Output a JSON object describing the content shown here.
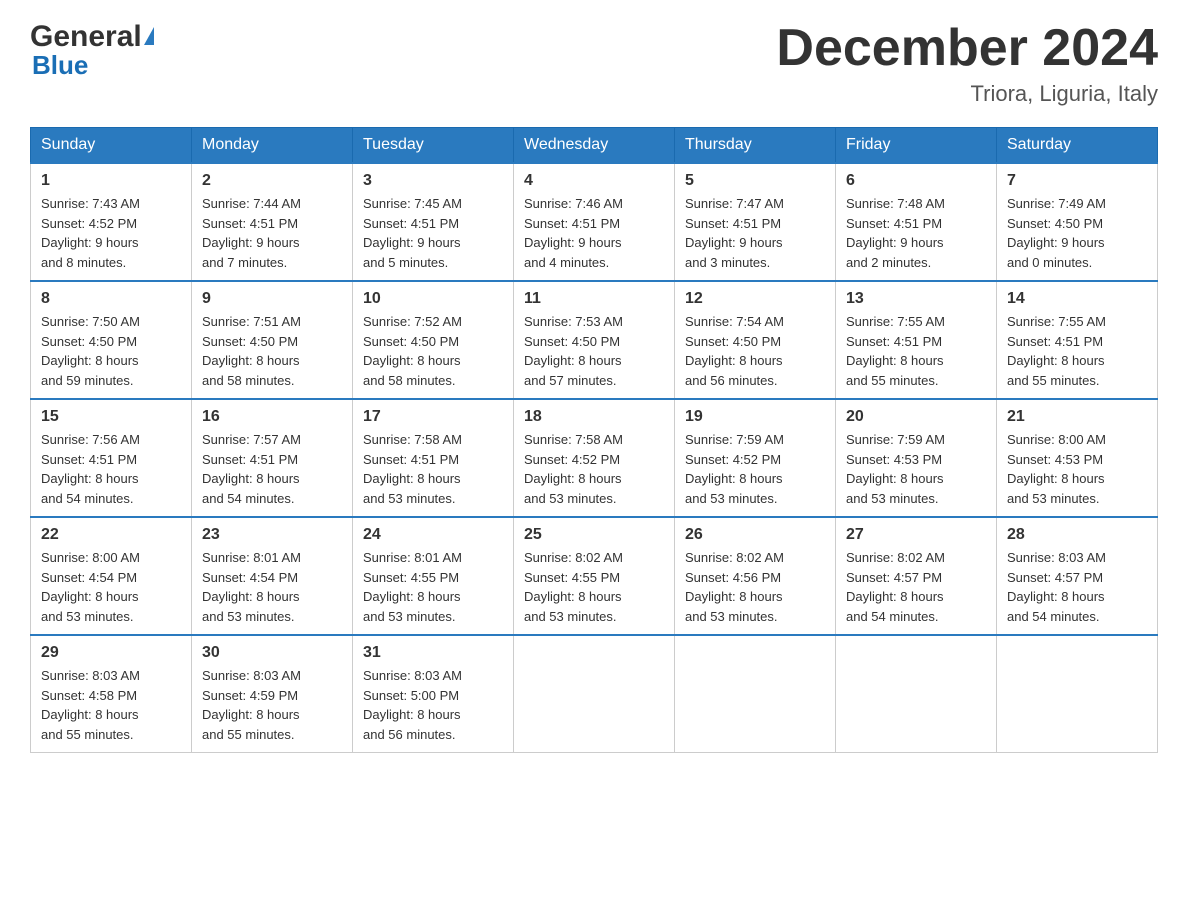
{
  "header": {
    "logo_general": "General",
    "logo_blue": "Blue",
    "month_title": "December 2024",
    "location": "Triora, Liguria, Italy"
  },
  "days_of_week": [
    "Sunday",
    "Monday",
    "Tuesday",
    "Wednesday",
    "Thursday",
    "Friday",
    "Saturday"
  ],
  "weeks": [
    [
      {
        "day": "1",
        "sunrise": "7:43 AM",
        "sunset": "4:52 PM",
        "daylight": "9 hours and 8 minutes."
      },
      {
        "day": "2",
        "sunrise": "7:44 AM",
        "sunset": "4:51 PM",
        "daylight": "9 hours and 7 minutes."
      },
      {
        "day": "3",
        "sunrise": "7:45 AM",
        "sunset": "4:51 PM",
        "daylight": "9 hours and 5 minutes."
      },
      {
        "day": "4",
        "sunrise": "7:46 AM",
        "sunset": "4:51 PM",
        "daylight": "9 hours and 4 minutes."
      },
      {
        "day": "5",
        "sunrise": "7:47 AM",
        "sunset": "4:51 PM",
        "daylight": "9 hours and 3 minutes."
      },
      {
        "day": "6",
        "sunrise": "7:48 AM",
        "sunset": "4:51 PM",
        "daylight": "9 hours and 2 minutes."
      },
      {
        "day": "7",
        "sunrise": "7:49 AM",
        "sunset": "4:50 PM",
        "daylight": "9 hours and 0 minutes."
      }
    ],
    [
      {
        "day": "8",
        "sunrise": "7:50 AM",
        "sunset": "4:50 PM",
        "daylight": "8 hours and 59 minutes."
      },
      {
        "day": "9",
        "sunrise": "7:51 AM",
        "sunset": "4:50 PM",
        "daylight": "8 hours and 58 minutes."
      },
      {
        "day": "10",
        "sunrise": "7:52 AM",
        "sunset": "4:50 PM",
        "daylight": "8 hours and 58 minutes."
      },
      {
        "day": "11",
        "sunrise": "7:53 AM",
        "sunset": "4:50 PM",
        "daylight": "8 hours and 57 minutes."
      },
      {
        "day": "12",
        "sunrise": "7:54 AM",
        "sunset": "4:50 PM",
        "daylight": "8 hours and 56 minutes."
      },
      {
        "day": "13",
        "sunrise": "7:55 AM",
        "sunset": "4:51 PM",
        "daylight": "8 hours and 55 minutes."
      },
      {
        "day": "14",
        "sunrise": "7:55 AM",
        "sunset": "4:51 PM",
        "daylight": "8 hours and 55 minutes."
      }
    ],
    [
      {
        "day": "15",
        "sunrise": "7:56 AM",
        "sunset": "4:51 PM",
        "daylight": "8 hours and 54 minutes."
      },
      {
        "day": "16",
        "sunrise": "7:57 AM",
        "sunset": "4:51 PM",
        "daylight": "8 hours and 54 minutes."
      },
      {
        "day": "17",
        "sunrise": "7:58 AM",
        "sunset": "4:51 PM",
        "daylight": "8 hours and 53 minutes."
      },
      {
        "day": "18",
        "sunrise": "7:58 AM",
        "sunset": "4:52 PM",
        "daylight": "8 hours and 53 minutes."
      },
      {
        "day": "19",
        "sunrise": "7:59 AM",
        "sunset": "4:52 PM",
        "daylight": "8 hours and 53 minutes."
      },
      {
        "day": "20",
        "sunrise": "7:59 AM",
        "sunset": "4:53 PM",
        "daylight": "8 hours and 53 minutes."
      },
      {
        "day": "21",
        "sunrise": "8:00 AM",
        "sunset": "4:53 PM",
        "daylight": "8 hours and 53 minutes."
      }
    ],
    [
      {
        "day": "22",
        "sunrise": "8:00 AM",
        "sunset": "4:54 PM",
        "daylight": "8 hours and 53 minutes."
      },
      {
        "day": "23",
        "sunrise": "8:01 AM",
        "sunset": "4:54 PM",
        "daylight": "8 hours and 53 minutes."
      },
      {
        "day": "24",
        "sunrise": "8:01 AM",
        "sunset": "4:55 PM",
        "daylight": "8 hours and 53 minutes."
      },
      {
        "day": "25",
        "sunrise": "8:02 AM",
        "sunset": "4:55 PM",
        "daylight": "8 hours and 53 minutes."
      },
      {
        "day": "26",
        "sunrise": "8:02 AM",
        "sunset": "4:56 PM",
        "daylight": "8 hours and 53 minutes."
      },
      {
        "day": "27",
        "sunrise": "8:02 AM",
        "sunset": "4:57 PM",
        "daylight": "8 hours and 54 minutes."
      },
      {
        "day": "28",
        "sunrise": "8:03 AM",
        "sunset": "4:57 PM",
        "daylight": "8 hours and 54 minutes."
      }
    ],
    [
      {
        "day": "29",
        "sunrise": "8:03 AM",
        "sunset": "4:58 PM",
        "daylight": "8 hours and 55 minutes."
      },
      {
        "day": "30",
        "sunrise": "8:03 AM",
        "sunset": "4:59 PM",
        "daylight": "8 hours and 55 minutes."
      },
      {
        "day": "31",
        "sunrise": "8:03 AM",
        "sunset": "5:00 PM",
        "daylight": "8 hours and 56 minutes."
      },
      null,
      null,
      null,
      null
    ]
  ]
}
